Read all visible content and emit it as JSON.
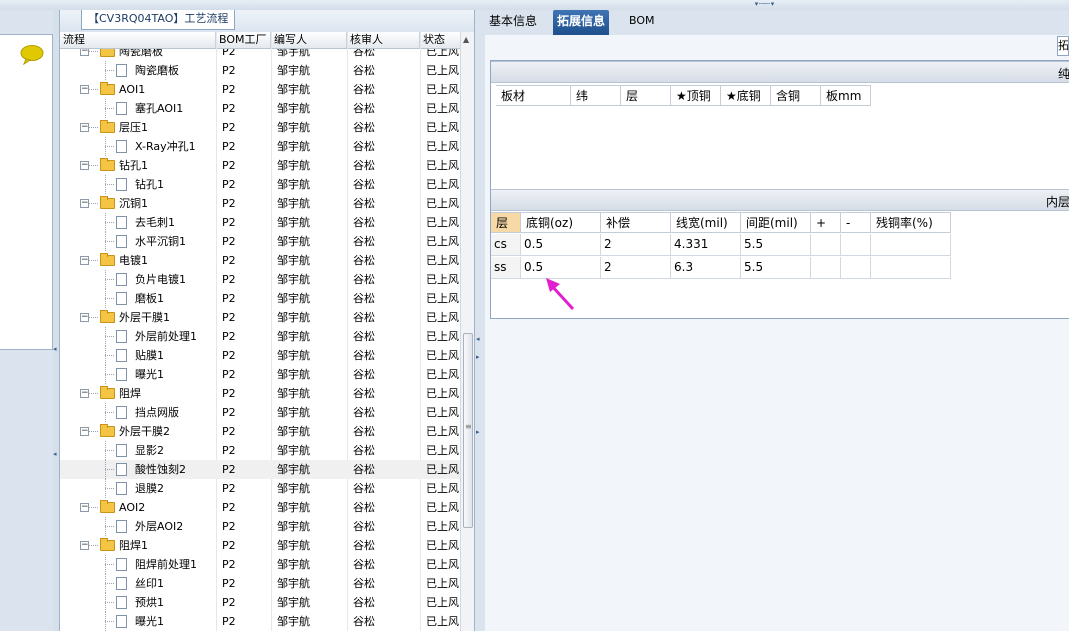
{
  "process_panel": {
    "title": "【CV3RQ04TAO】工艺流程",
    "columns": [
      "流程",
      "BOM工厂",
      "编写人",
      "核审人",
      "状态"
    ],
    "rows": [
      {
        "level": 0,
        "name": "陶瓷磨板",
        "bom": "P2",
        "writer": "邹宇航",
        "checker": "谷松",
        "status": "已上风"
      },
      {
        "level": 1,
        "name": "陶瓷磨板",
        "bom": "P2",
        "writer": "邹宇航",
        "checker": "谷松",
        "status": "已上风"
      },
      {
        "level": 0,
        "name": "AOI1",
        "bom": "P2",
        "writer": "邹宇航",
        "checker": "谷松",
        "status": "已上风"
      },
      {
        "level": 1,
        "name": "塞孔AOI1",
        "bom": "P2",
        "writer": "邹宇航",
        "checker": "谷松",
        "status": "已上风"
      },
      {
        "level": 0,
        "name": "层压1",
        "bom": "P2",
        "writer": "邹宇航",
        "checker": "谷松",
        "status": "已上风"
      },
      {
        "level": 1,
        "name": "X-Ray冲孔1",
        "bom": "P2",
        "writer": "邹宇航",
        "checker": "谷松",
        "status": "已上风"
      },
      {
        "level": 0,
        "name": "钻孔1",
        "bom": "P2",
        "writer": "邹宇航",
        "checker": "谷松",
        "status": "已上风"
      },
      {
        "level": 1,
        "name": "钻孔1",
        "bom": "P2",
        "writer": "邹宇航",
        "checker": "谷松",
        "status": "已上风"
      },
      {
        "level": 0,
        "name": "沉铜1",
        "bom": "P2",
        "writer": "邹宇航",
        "checker": "谷松",
        "status": "已上风"
      },
      {
        "level": 1,
        "name": "去毛刺1",
        "bom": "P2",
        "writer": "邹宇航",
        "checker": "谷松",
        "status": "已上风"
      },
      {
        "level": 1,
        "name": "水平沉铜1",
        "bom": "P2",
        "writer": "邹宇航",
        "checker": "谷松",
        "status": "已上风"
      },
      {
        "level": 0,
        "name": "电镀1",
        "bom": "P2",
        "writer": "邹宇航",
        "checker": "谷松",
        "status": "已上风"
      },
      {
        "level": 1,
        "name": "负片电镀1",
        "bom": "P2",
        "writer": "邹宇航",
        "checker": "谷松",
        "status": "已上风"
      },
      {
        "level": 1,
        "name": "磨板1",
        "bom": "P2",
        "writer": "邹宇航",
        "checker": "谷松",
        "status": "已上风"
      },
      {
        "level": 0,
        "name": "外层干膜1",
        "bom": "P2",
        "writer": "邹宇航",
        "checker": "谷松",
        "status": "已上风"
      },
      {
        "level": 1,
        "name": "外层前处理1",
        "bom": "P2",
        "writer": "邹宇航",
        "checker": "谷松",
        "status": "已上风"
      },
      {
        "level": 1,
        "name": "贴膜1",
        "bom": "P2",
        "writer": "邹宇航",
        "checker": "谷松",
        "status": "已上风"
      },
      {
        "level": 1,
        "name": "曝光1",
        "bom": "P2",
        "writer": "邹宇航",
        "checker": "谷松",
        "status": "已上风"
      },
      {
        "level": 0,
        "name": "阻焊",
        "bom": "P2",
        "writer": "邹宇航",
        "checker": "谷松",
        "status": "已上风"
      },
      {
        "level": 1,
        "name": "挡点网版",
        "bom": "P2",
        "writer": "邹宇航",
        "checker": "谷松",
        "status": "已上风"
      },
      {
        "level": 0,
        "name": "外层干膜2",
        "bom": "P2",
        "writer": "邹宇航",
        "checker": "谷松",
        "status": "已上风"
      },
      {
        "level": 1,
        "name": "显影2",
        "bom": "P2",
        "writer": "邹宇航",
        "checker": "谷松",
        "status": "已上风"
      },
      {
        "level": 1,
        "name": "酸性蚀刻2",
        "bom": "P2",
        "writer": "邹宇航",
        "checker": "谷松",
        "status": "已上风"
      },
      {
        "level": 1,
        "name": "退膜2",
        "bom": "P2",
        "writer": "邹宇航",
        "checker": "谷松",
        "status": "已上风"
      },
      {
        "level": 0,
        "name": "AOI2",
        "bom": "P2",
        "writer": "邹宇航",
        "checker": "谷松",
        "status": "已上风"
      },
      {
        "level": 1,
        "name": "外层AOI2",
        "bom": "P2",
        "writer": "邹宇航",
        "checker": "谷松",
        "status": "已上风"
      },
      {
        "level": 0,
        "name": "阻焊1",
        "bom": "P2",
        "writer": "邹宇航",
        "checker": "谷松",
        "status": "已上风"
      },
      {
        "level": 1,
        "name": "阻焊前处理1",
        "bom": "P2",
        "writer": "邹宇航",
        "checker": "谷松",
        "status": "已上风"
      },
      {
        "level": 1,
        "name": "丝印1",
        "bom": "P2",
        "writer": "邹宇航",
        "checker": "谷松",
        "status": "已上风"
      },
      {
        "level": 1,
        "name": "预烘1",
        "bom": "P2",
        "writer": "邹宇航",
        "checker": "谷松",
        "status": "已上风"
      },
      {
        "level": 1,
        "name": "曝光1",
        "bom": "P2",
        "writer": "邹宇航",
        "checker": "谷松",
        "status": "已上风"
      }
    ],
    "selected_row": 22
  },
  "tabs": {
    "items": [
      "基本信息",
      "拓展信息",
      "BOM"
    ],
    "active": 1
  },
  "right_edge_button": "拓",
  "section_pure": {
    "title": "纯",
    "columns": [
      "板材",
      "纬",
      "层",
      "★顶铜",
      "★底铜",
      "含铜",
      "板mm"
    ]
  },
  "section_inner": {
    "title": "内层",
    "columns": [
      "层",
      "底铜(oz)",
      "补偿",
      "线宽(mil)",
      "间距(mil)",
      "+",
      "-",
      "残铜率(%)"
    ],
    "rows": [
      {
        "layer": "cs",
        "base_copper": "0.5",
        "compensation": "2",
        "line_width": "4.331",
        "spacing": "5.5",
        "plus": "",
        "minus": "",
        "residual": ""
      },
      {
        "layer": "ss",
        "base_copper": "0.5",
        "compensation": "2",
        "line_width": "6.3",
        "spacing": "5.5",
        "plus": "",
        "minus": "",
        "residual": ""
      }
    ]
  },
  "colors": {
    "accent": "#2a5d9f",
    "annotation_arrow": "#e020d0",
    "selected_header": "#f7d9a8"
  },
  "icons": {
    "chat": "speech-bubble-icon",
    "folder": "folder-icon",
    "document": "document-icon"
  }
}
